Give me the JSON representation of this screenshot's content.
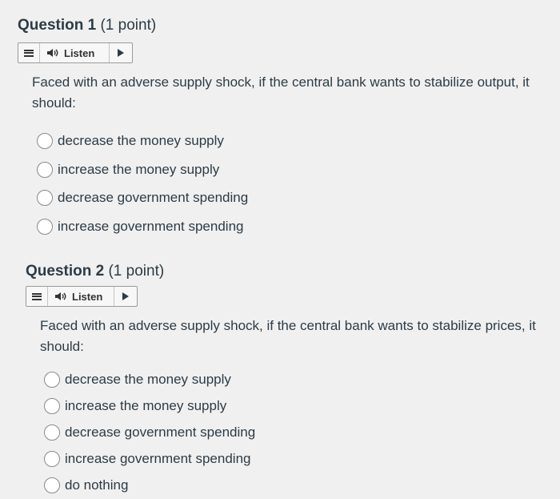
{
  "questions": [
    {
      "number": "Question 1",
      "points": "(1 point)",
      "listen_label": "Listen",
      "prompt": "Faced with an adverse supply shock, if the central bank wants to stabilize output, it should:",
      "options": [
        "decrease the money supply",
        "increase the money supply",
        "decrease government spending",
        "increase government spending"
      ]
    },
    {
      "number": "Question 2",
      "points": "(1 point)",
      "listen_label": "Listen",
      "prompt": "Faced with an adverse supply shock, if the central bank wants to stabilize prices, it should:",
      "options": [
        "decrease the money supply",
        "increase the money supply",
        "decrease government spending",
        "increase government spending",
        "do nothing"
      ]
    }
  ]
}
